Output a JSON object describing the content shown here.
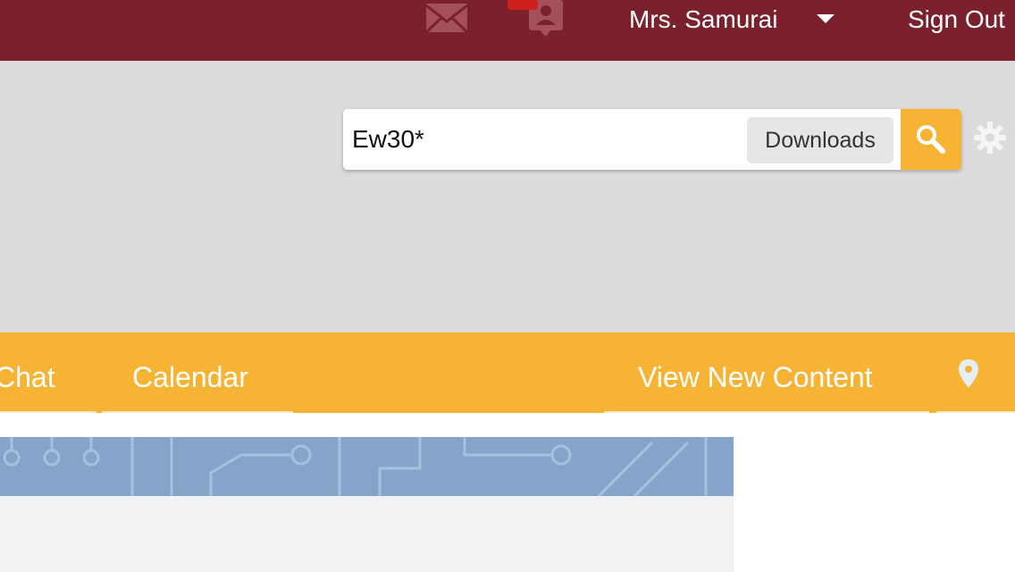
{
  "topbar": {
    "user_name": "Mrs. Samurai",
    "sign_out": "Sign Out",
    "notification_count": "",
    "icons": [
      "mail-icon",
      "contact-icon",
      "chevron-down-icon"
    ]
  },
  "search": {
    "value": "Ew30*",
    "scope": "Downloads",
    "icons": [
      "search-icon",
      "gear-icon"
    ]
  },
  "nav": {
    "items": [
      {
        "label": "Chat"
      },
      {
        "label": "Calendar"
      },
      {
        "label": "View New Content"
      }
    ],
    "icons": [
      "map-pin-icon"
    ]
  },
  "colors": {
    "topbar": "#7a212d",
    "header_bg": "#dcdcdc",
    "accent": "#f6b334",
    "banner": "#84a5c9",
    "content_bg": "#f2f1f4"
  }
}
